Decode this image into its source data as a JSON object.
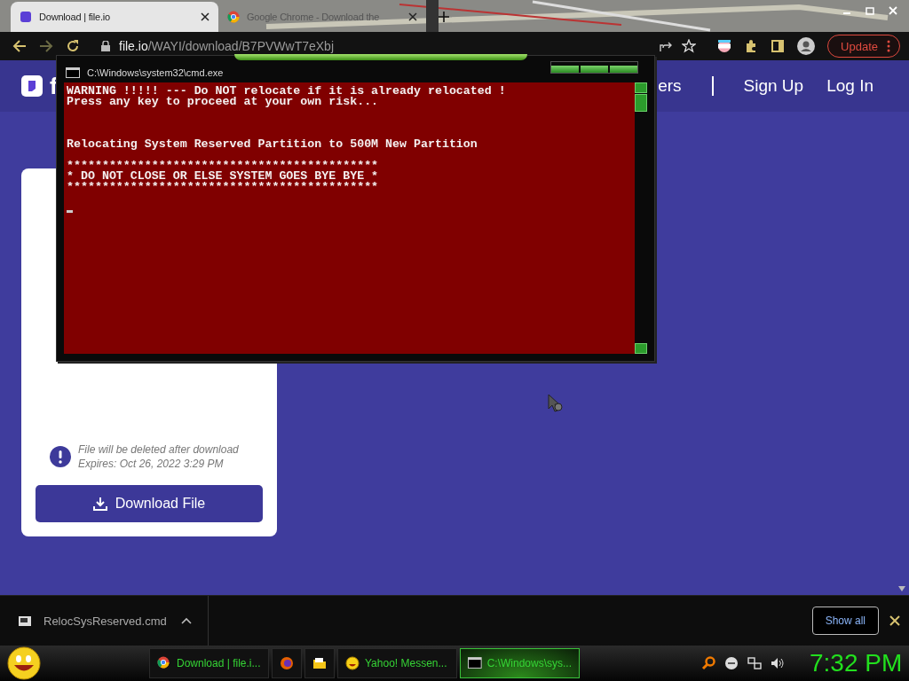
{
  "browser": {
    "tabs": [
      {
        "title": "Download | file.io",
        "selected": true
      },
      {
        "title": "Google Chrome - Download the",
        "selected": false
      }
    ],
    "address": {
      "host": "file.io",
      "path": "/WAYI/download/B7PVWwT7eXbj"
    },
    "update_button": "Update"
  },
  "page": {
    "logo_text": "f",
    "nav": [
      {
        "label": "ers"
      },
      {
        "label": "Sign Up"
      },
      {
        "label": "Log In"
      }
    ],
    "notice": [
      "File will be deleted after download",
      "Expires: Oct 26, 2022 3:29 PM"
    ],
    "download_button": "Download File"
  },
  "console": {
    "title": "C:\\Windows\\system32\\cmd.exe",
    "output": "WARNING !!!!! --- Do NOT relocate if it is already relocated !\nPress any key to proceed at your own risk...\n\n\n\nRelocating System Reserved Partition to 500M New Partition\n\n********************************************\n* DO NOT CLOSE OR ELSE SYSTEM GOES BYE BYE *\n********************************************"
  },
  "downloads": {
    "filename": "RelocSysReserved.cmd",
    "show_all": "Show all"
  },
  "taskbar": {
    "buttons": [
      {
        "kind": "chrome",
        "label": "Download | file.i...",
        "selected": false
      },
      {
        "kind": "firefox",
        "selected": false
      },
      {
        "kind": "folder",
        "selected": false
      },
      {
        "kind": "smiley",
        "label": "Yahoo! Messen...",
        "selected": false
      },
      {
        "kind": "cmd",
        "label": "C:\\Windows\\sys...",
        "selected": true
      }
    ],
    "clock": "7:32 PM"
  }
}
